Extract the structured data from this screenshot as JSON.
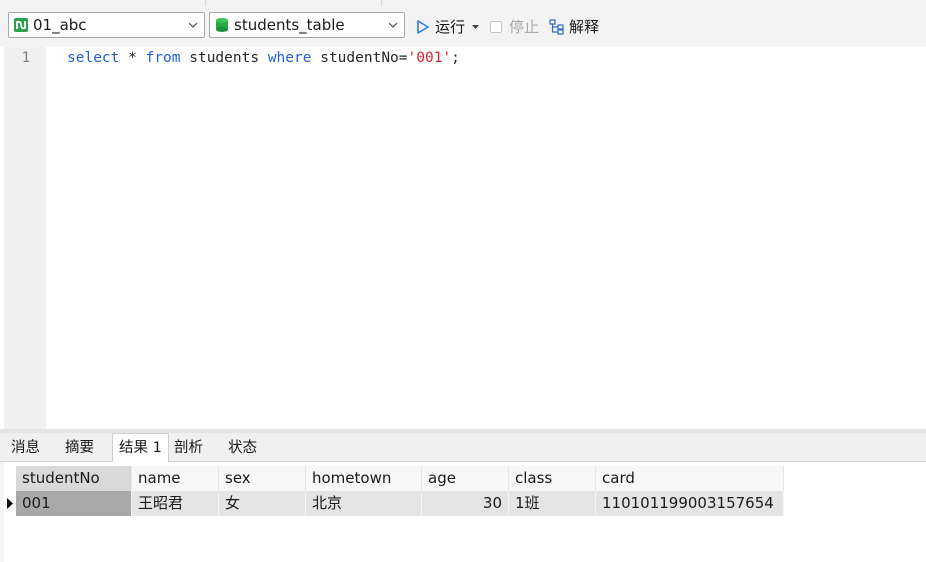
{
  "toolbar": {
    "connection": "01_abc",
    "database": "students_table",
    "run_label": "运行",
    "stop_label": "停止",
    "explain_label": "解释"
  },
  "editor": {
    "line_number": "1",
    "tokens": [
      {
        "text": "select",
        "kind": "kw"
      },
      {
        "text": " * ",
        "kind": "plain"
      },
      {
        "text": "from",
        "kind": "kw"
      },
      {
        "text": " students ",
        "kind": "plain"
      },
      {
        "text": "where",
        "kind": "kw"
      },
      {
        "text": " studentNo=",
        "kind": "plain"
      },
      {
        "text": "'001'",
        "kind": "str"
      },
      {
        "text": ";",
        "kind": "plain"
      }
    ]
  },
  "result_tabs": [
    "消息",
    "摘要",
    "结果 1",
    "剖析",
    "状态"
  ],
  "active_tab": "结果 1",
  "grid": {
    "columns": [
      "studentNo",
      "name",
      "sex",
      "hometown",
      "age",
      "class",
      "card"
    ],
    "rows": [
      [
        "001",
        "王昭君",
        "女",
        "北京",
        "30",
        "1班",
        "110101199003157654"
      ]
    ]
  },
  "colors": {
    "keyword": "#1f5fd8",
    "string": "#d2232a",
    "run_icon": "#2b7de9",
    "db_icon": "#27a845",
    "conn_icon": "#2e9e4f"
  },
  "icons": [
    "connection-icon",
    "database-icon",
    "run-icon",
    "stop-icon",
    "explain-icon",
    "chevron-down-icon",
    "row-pointer-icon"
  ]
}
